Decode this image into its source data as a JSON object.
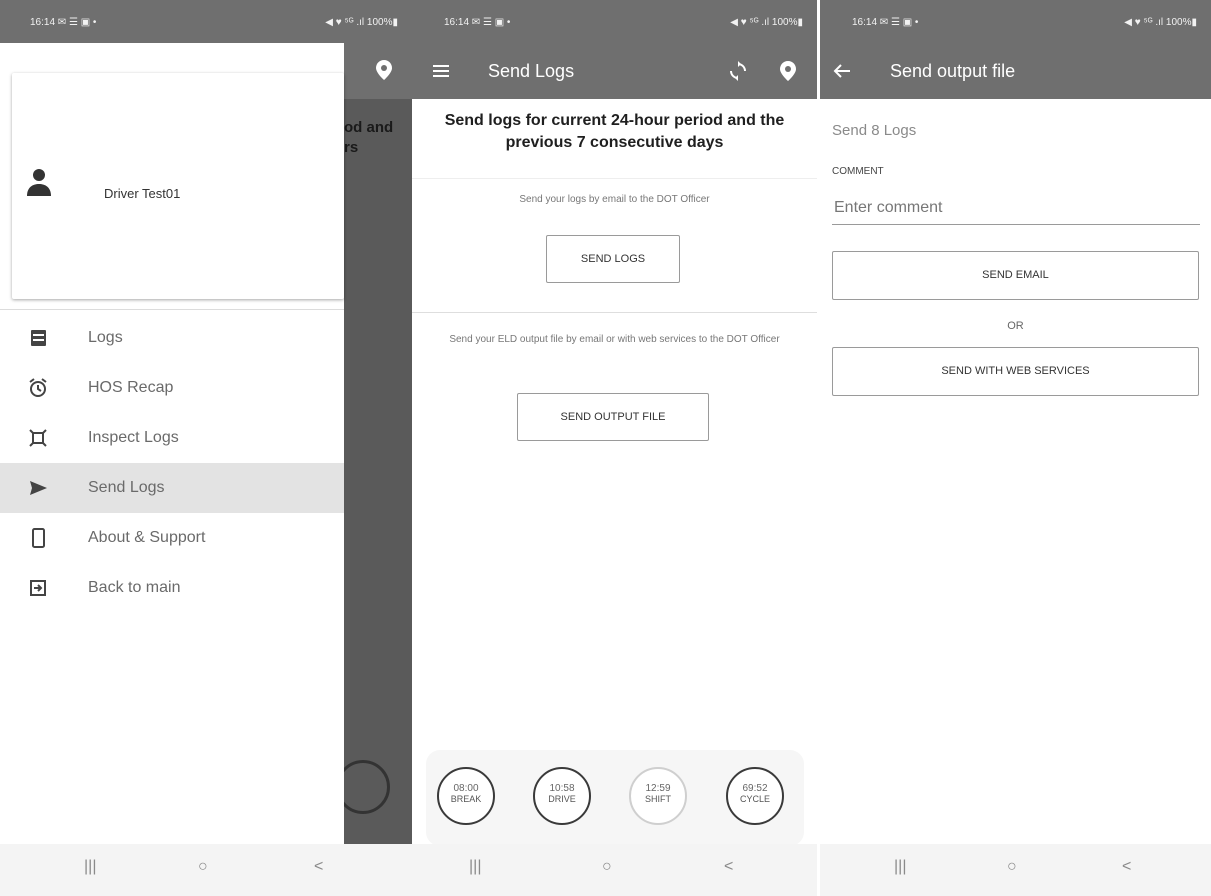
{
  "status_bar": {
    "left": "16:14 ✉ ☰ ▣ •",
    "right": "◀ ♥ ⁵ᴳ .ıl 100%▮"
  },
  "colors": {
    "appbar": "#6f6f6f",
    "scrim": "#5a5a5a",
    "active_item": "#e3e3e3"
  },
  "panel_drawer": {
    "user_name": "Driver Test01",
    "background_heading": "od and\nrs",
    "menu": [
      {
        "label": "Logs",
        "icon": "logs-icon"
      },
      {
        "label": "HOS Recap",
        "icon": "alarm-clock-icon"
      },
      {
        "label": "Inspect Logs",
        "icon": "inspect-icon"
      },
      {
        "label": "Send Logs",
        "icon": "send-icon",
        "active": true
      },
      {
        "label": "About & Support",
        "icon": "phone-icon"
      },
      {
        "label": "Back to main",
        "icon": "exit-icon"
      }
    ]
  },
  "panel_send_logs": {
    "title": "Send Logs",
    "heading": "Send logs for current 24-hour period and the previous 7 consecutive days",
    "email_desc": "Send your logs by email to the DOT Officer",
    "send_logs_button": "SEND LOGS",
    "output_desc": "Send your ELD output file by email or with web services to the DOT Officer",
    "send_output_button": "SEND OUTPUT FILE",
    "timers": [
      {
        "value": "08:00",
        "label": "BREAK"
      },
      {
        "value": "10:58",
        "label": "DRIVE"
      },
      {
        "value": "12:59",
        "label": "SHIFT"
      },
      {
        "value": "69:52",
        "label": "CYCLE"
      }
    ]
  },
  "panel_output_file": {
    "title": "Send output file",
    "subtitle": "Send 8 Logs",
    "comment_label": "COMMENT",
    "comment_placeholder": "Enter comment",
    "send_email_button": "SEND EMAIL",
    "or_text": "OR",
    "web_services_button": "SEND WITH WEB SERVICES"
  },
  "nav_bar": {
    "recents": "|||",
    "home": "○",
    "back": "<"
  }
}
